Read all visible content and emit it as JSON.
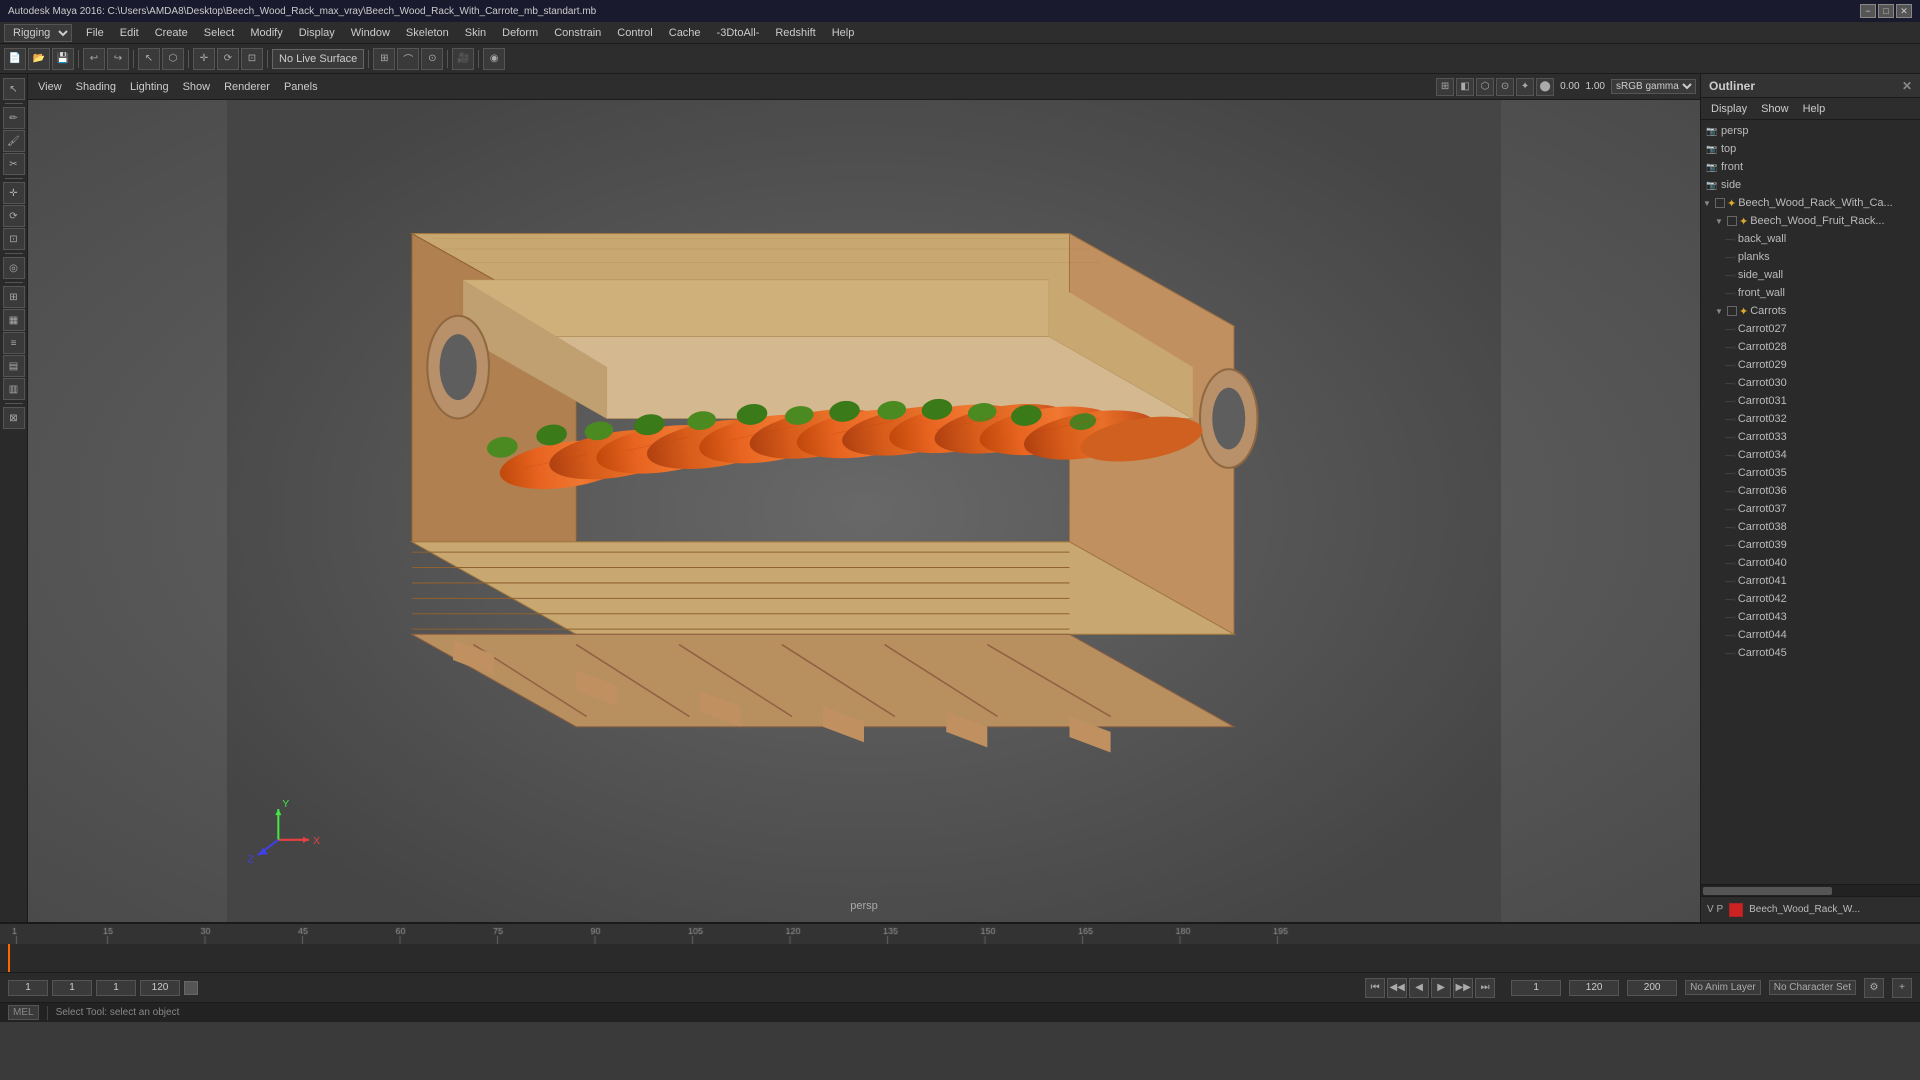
{
  "titleBar": {
    "title": "Autodesk Maya 2016: C:\\Users\\AMDA8\\Desktop\\Beech_Wood_Rack_max_vray\\Beech_Wood_Rack_With_Carrote_mb_standart.mb",
    "minBtn": "−",
    "maxBtn": "□",
    "closeBtn": "✕"
  },
  "menuBar": {
    "items": [
      "File",
      "Edit",
      "Create",
      "Select",
      "Modify",
      "Display",
      "Window",
      "Skeleton",
      "Skin",
      "Deform",
      "Constrain",
      "Control",
      "Cache",
      "-3DtoAll-",
      "Redshift",
      "Help"
    ],
    "modeSelector": "Rigging"
  },
  "viewportMenu": {
    "items": [
      "View",
      "Shading",
      "Lighting",
      "Show",
      "Renderer",
      "Panels"
    ]
  },
  "lighting": "Lighting",
  "noLiveSurface": "No Live Surface",
  "viewport": {
    "label": "persp",
    "colorSpace": "sRGB gamma",
    "val1": "0.00",
    "val2": "1.00"
  },
  "outliner": {
    "title": "Outliner",
    "menuItems": [
      "Display",
      "Show",
      "Help"
    ],
    "cameras": [
      {
        "name": "persp",
        "type": "camera"
      },
      {
        "name": "top",
        "type": "camera"
      },
      {
        "name": "front",
        "type": "camera"
      },
      {
        "name": "side",
        "type": "camera"
      }
    ],
    "sceneItems": [
      {
        "name": "Beech_Wood_Rack_With_Ca...",
        "type": "group",
        "level": 0,
        "expanded": true
      },
      {
        "name": "Beech_Wood_Fruit_Rack...",
        "type": "group",
        "level": 1,
        "expanded": true
      },
      {
        "name": "back_wall",
        "type": "mesh",
        "level": 2
      },
      {
        "name": "planks",
        "type": "mesh",
        "level": 2
      },
      {
        "name": "side_wall",
        "type": "mesh",
        "level": 2
      },
      {
        "name": "front_wall",
        "type": "mesh",
        "level": 2
      },
      {
        "name": "Carrots",
        "type": "group",
        "level": 1,
        "expanded": true
      },
      {
        "name": "Carrot027",
        "type": "mesh",
        "level": 2
      },
      {
        "name": "Carrot028",
        "type": "mesh",
        "level": 2
      },
      {
        "name": "Carrot029",
        "type": "mesh",
        "level": 2
      },
      {
        "name": "Carrot030",
        "type": "mesh",
        "level": 2
      },
      {
        "name": "Carrot031",
        "type": "mesh",
        "level": 2
      },
      {
        "name": "Carrot032",
        "type": "mesh",
        "level": 2
      },
      {
        "name": "Carrot033",
        "type": "mesh",
        "level": 2
      },
      {
        "name": "Carrot034",
        "type": "mesh",
        "level": 2
      },
      {
        "name": "Carrot035",
        "type": "mesh",
        "level": 2
      },
      {
        "name": "Carrot036",
        "type": "mesh",
        "level": 2
      },
      {
        "name": "Carrot037",
        "type": "mesh",
        "level": 2
      },
      {
        "name": "Carrot038",
        "type": "mesh",
        "level": 2
      },
      {
        "name": "Carrot039",
        "type": "mesh",
        "level": 2
      },
      {
        "name": "Carrot040",
        "type": "mesh",
        "level": 2
      },
      {
        "name": "Carrot041",
        "type": "mesh",
        "level": 2
      },
      {
        "name": "Carrot042",
        "type": "mesh",
        "level": 2
      },
      {
        "name": "Carrot043",
        "type": "mesh",
        "level": 2
      },
      {
        "name": "Carrot044",
        "type": "mesh",
        "level": 2
      },
      {
        "name": "Carrot045",
        "type": "mesh",
        "level": 2
      }
    ]
  },
  "channelsPanel": {
    "label": "V P",
    "item": "Beech_Wood_Rack_W..."
  },
  "timeline": {
    "startFrame": 1,
    "endFrame": 120,
    "currentFrame": 1,
    "totalFrames": 200,
    "ticks": [
      "1",
      "15",
      "30",
      "45",
      "60",
      "75",
      "90",
      "105",
      "120",
      "135",
      "150",
      "165",
      "180",
      "195"
    ]
  },
  "playback": {
    "buttons": [
      "⏮",
      "⏭",
      "◀◀",
      "◀",
      "▶",
      "▶▶",
      "⏭",
      "⏮"
    ],
    "animLayerLabel": "No Anim Layer",
    "charSetLabel": "No Character Set"
  },
  "statusBar": {
    "scriptLabel": "MEL",
    "helpText": "Select Tool: select an object"
  },
  "leftToolbar": {
    "tools": [
      "↖",
      "⬡",
      "↔",
      "⟳",
      "⊡",
      "⊞",
      "⊙",
      "◎",
      "❑",
      "⊠",
      "☰",
      "▦",
      "▤",
      "▥"
    ]
  }
}
